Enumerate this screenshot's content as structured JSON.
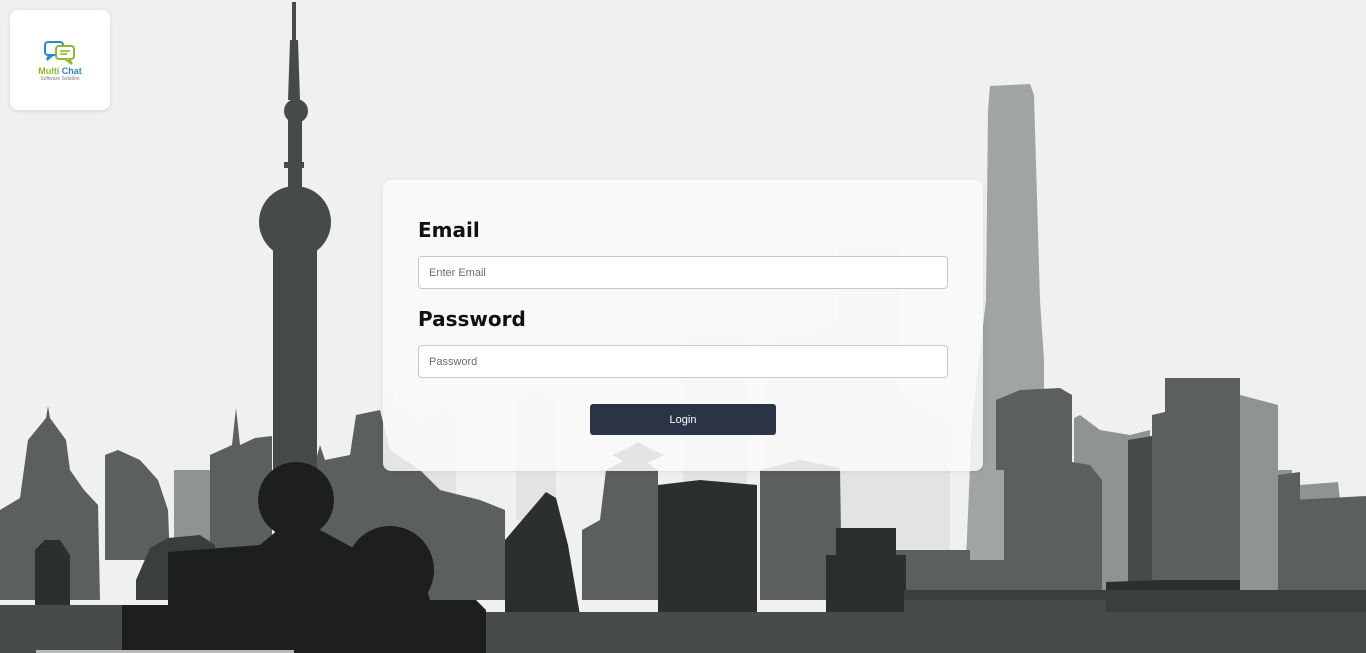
{
  "logo": {
    "title_part1": "Multi",
    "title_part2": " Chat",
    "subtitle": "Software Solution",
    "colors": {
      "green": "#8cb82b",
      "blue": "#2f86c4"
    },
    "icon": "chat-bubbles-icon"
  },
  "login_form": {
    "email_label": "Email",
    "email_placeholder": "Enter Email",
    "email_value": "",
    "password_label": "Password",
    "password_placeholder": "Password",
    "password_value": "",
    "login_button_label": "Login"
  },
  "background": {
    "icon": "city-skyline-illustration"
  },
  "colors": {
    "page_background": "#f0f0f0",
    "button": "#2b3447",
    "button_text": "#ffffff",
    "skyline_dark": "#1d1f1f",
    "skyline_mid": "#474a4a",
    "skyline_light": "#9fa3a2"
  }
}
